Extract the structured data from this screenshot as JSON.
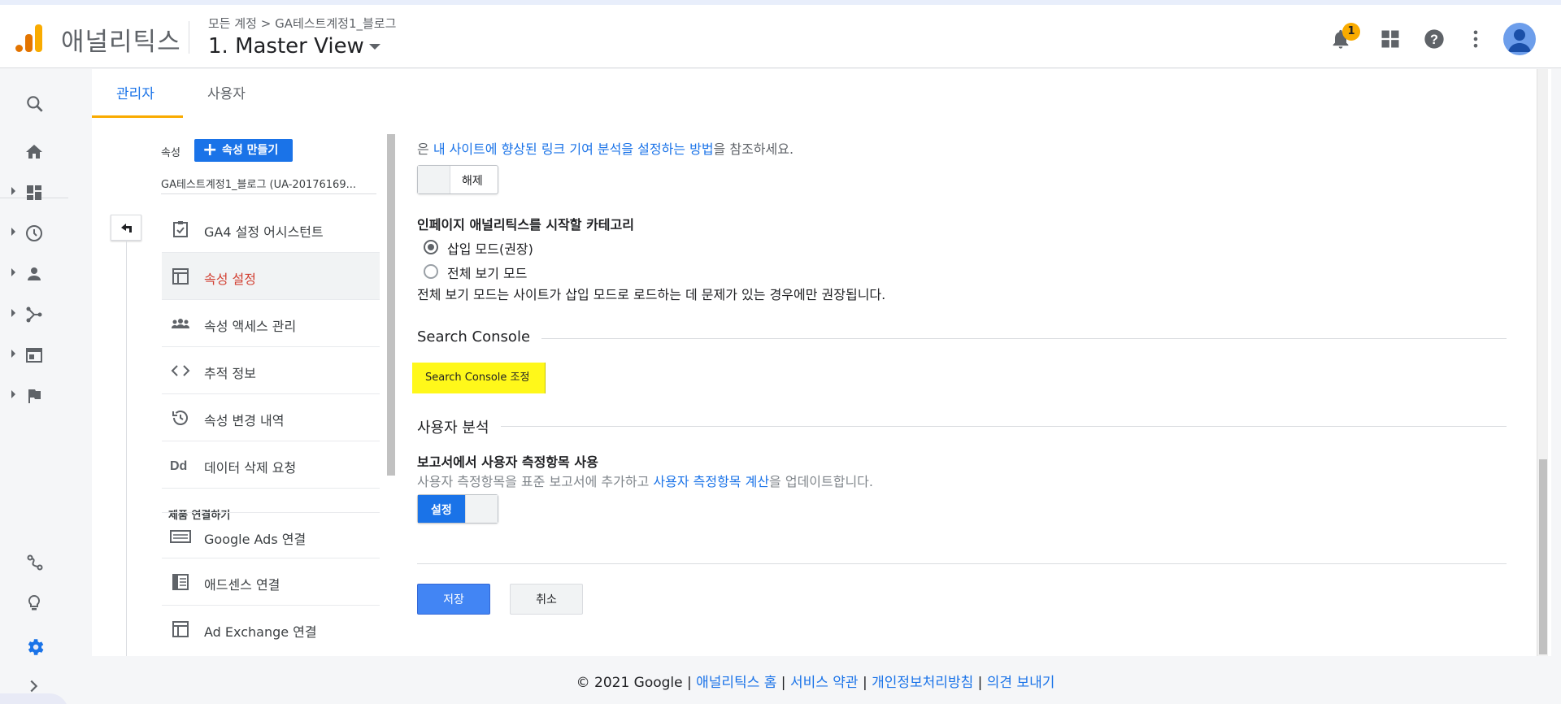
{
  "header": {
    "brand": "애널리틱스",
    "breadcrumb": "모든 계정 > GA테스트계정1_블로그",
    "view_name": "1. Master View",
    "notification_count": "1"
  },
  "rail": {
    "items": [
      "search-icon",
      "home-icon",
      "customization-icon",
      "realtime-icon",
      "audience-icon",
      "acquisition-icon",
      "behavior-icon",
      "conversions-icon",
      "attribution-icon",
      "discover-icon",
      "admin-icon",
      "expand-icon"
    ]
  },
  "tabs": [
    {
      "label": "관리자"
    },
    {
      "label": "사용자"
    }
  ],
  "property": {
    "label": "속성",
    "create_button": "속성 만들기",
    "name": "GA테스트계정1_블로그 (UA-20176169..."
  },
  "menu": {
    "items": [
      {
        "label": "GA4 설정 어시스턴트"
      },
      {
        "label": "속성 설정"
      },
      {
        "label": "속성 액세스 관리"
      },
      {
        "label": "추적 정보"
      },
      {
        "label": "속성 변경 내역"
      },
      {
        "label": "데이터 삭제 요청"
      }
    ],
    "section_header": "제품 연결하기",
    "links": [
      {
        "label": "Google Ads 연결"
      },
      {
        "label": "애드센스 연결"
      },
      {
        "label": "Ad Exchange 연결"
      }
    ]
  },
  "content": {
    "link_attr_prefix": "은 ",
    "link_attr_link": "내 사이트에 향상된 링크 기여 분석을 설정하는 방법",
    "link_attr_suffix": "을 참조하세요.",
    "toggle1_label": "해제",
    "inpage_heading": "인페이지 애널리틱스를 시작할 카테고리",
    "radio1": "삽입 모드(권장)",
    "radio2": "전체 보기 모드",
    "inpage_note": "전체 보기 모드는 사이트가 삽입 모드로 로드하는 데 문제가 있는 경우에만 권장됩니다.",
    "search_console_title": "Search Console",
    "search_console_button": "Search Console 조정",
    "user_analysis_title": "사용자 분석",
    "user_metric_heading": "보고서에서 사용자 측정항목 사용",
    "user_metric_desc_prefix": "사용자 측정항목을 표준 보고서에 추가하고 ",
    "user_metric_desc_link": "사용자 측정항목 계산",
    "user_metric_desc_suffix": "을 업데이트합니다.",
    "toggle2_label": "설정",
    "save_button": "저장",
    "cancel_button": "취소"
  },
  "footer": {
    "copyright": "© 2021 Google | ",
    "links": [
      "애널리틱스 홈",
      "서비스 약관",
      "개인정보처리방침",
      "의견 보내기"
    ],
    "sep": " | "
  },
  "colors": {
    "accent_blue": "#1a73e8",
    "active_red": "#d23f31",
    "highlight_yellow": "#fff81a",
    "badge_orange": "#f9ab00"
  }
}
